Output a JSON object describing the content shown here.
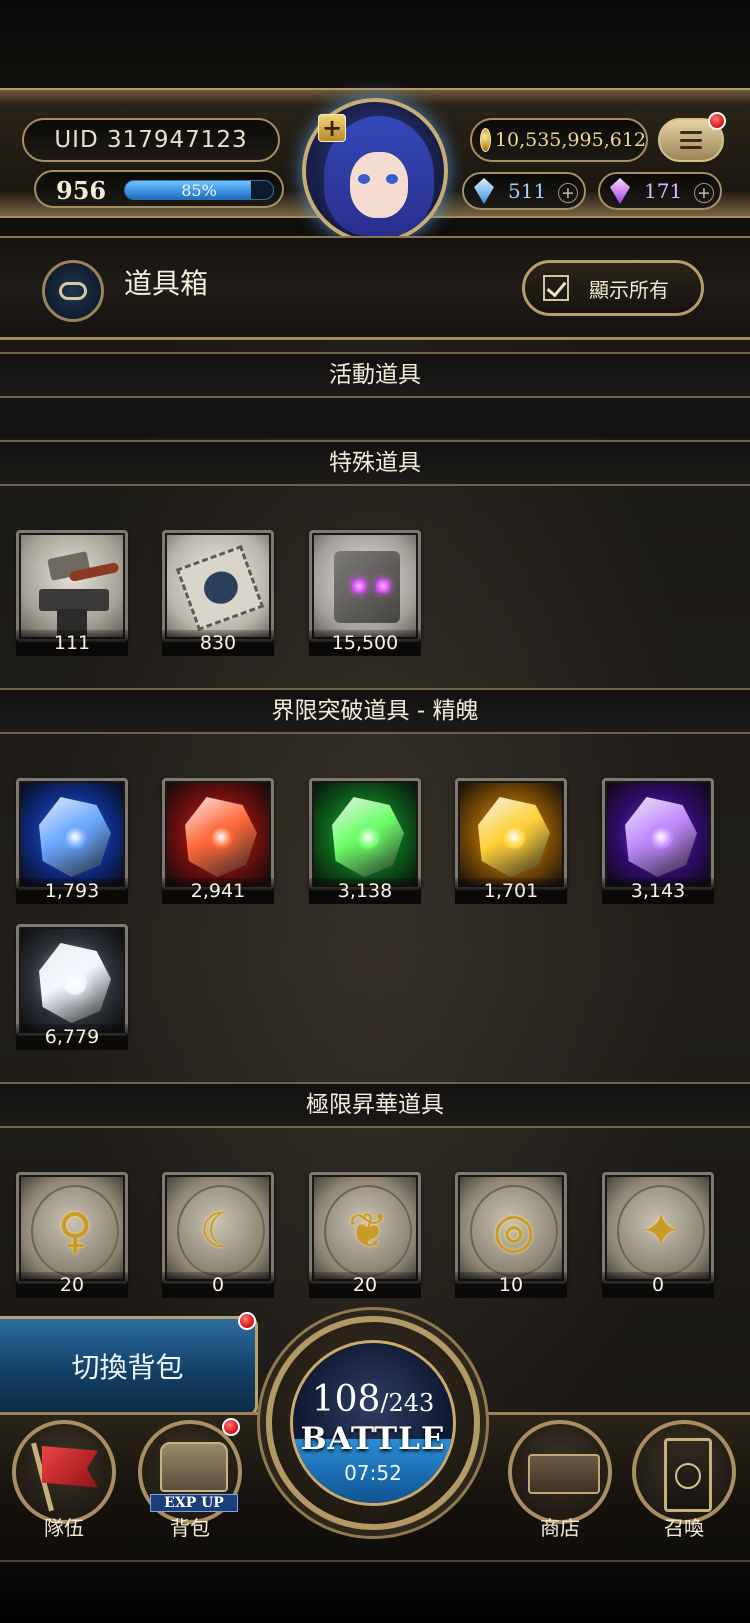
{
  "header": {
    "uid": "UID 317947123",
    "level": "956",
    "exp_percent_label": "85%",
    "exp_fraction": 0.85,
    "gold": "10,535,995,612",
    "blue_gems": "511",
    "purple_gems": "171",
    "plus": "+"
  },
  "page": {
    "title": "道具箱",
    "show_all_label": "顯示所有"
  },
  "sections": [
    {
      "title": "活動道具",
      "items": []
    },
    {
      "title": "特殊道具",
      "items": [
        {
          "icon": "hammer-anvil-icon",
          "count": "111"
        },
        {
          "icon": "ticket-icon",
          "count": "830"
        },
        {
          "icon": "stone-cube-icon",
          "count": "15,500"
        }
      ]
    },
    {
      "title": "界限突破道具 - 精魄",
      "items": [
        {
          "icon": "blue-crystal-icon",
          "count": "1,793",
          "color": "#4a8cff"
        },
        {
          "icon": "red-crystal-icon",
          "count": "2,941",
          "color": "#ff4a3a"
        },
        {
          "icon": "green-crystal-icon",
          "count": "3,138",
          "color": "#3adf5a"
        },
        {
          "icon": "yellow-crystal-icon",
          "count": "1,701",
          "color": "#ffc21a"
        },
        {
          "icon": "purple-crystal-icon",
          "count": "3,143",
          "color": "#a65bff"
        },
        {
          "icon": "white-crystal-icon",
          "count": "6,779",
          "color": "#e8eef8"
        }
      ]
    },
    {
      "title": "極限昇華道具",
      "items": [
        {
          "icon": "rune-stone-1-icon",
          "count": "20"
        },
        {
          "icon": "rune-stone-2-icon",
          "count": "0"
        },
        {
          "icon": "rune-stone-3-icon",
          "count": "20"
        },
        {
          "icon": "rune-stone-4-icon",
          "count": "10"
        },
        {
          "icon": "rune-stone-5-icon",
          "count": "0"
        }
      ]
    }
  ],
  "switch_bag_label": "切換背包",
  "battle": {
    "stamina_current": "108",
    "stamina_max": "/243",
    "label": "BATTLE",
    "timer": "07:52"
  },
  "nav": {
    "team": "隊伍",
    "bag": "背包",
    "exp_up": "EXP UP",
    "shop": "商店",
    "summon": "召喚"
  }
}
